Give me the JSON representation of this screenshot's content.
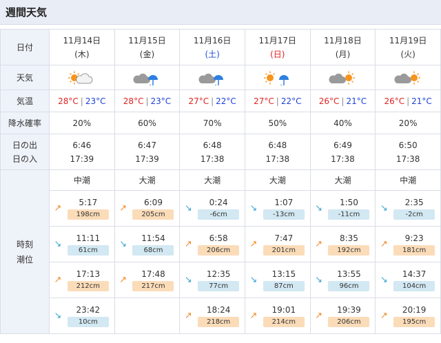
{
  "title": "週間天気",
  "labels": {
    "date": "日付",
    "weather": "天気",
    "temp": "気温",
    "rain": "降水確率",
    "sunrise": "日の出",
    "sunset": "日の入",
    "tide_time": "時刻",
    "tide_level": "潮位"
  },
  "days": [
    {
      "date": "11月14日",
      "dow": "(木)",
      "dow_type": "weekday",
      "weather_icon": "sun-cloud-icon",
      "hi": "28°C",
      "lo": "23°C",
      "rain": "20%",
      "sunrise": "6:46",
      "sunset": "17:39",
      "tide_name": "中潮",
      "tides": [
        {
          "dir": "up",
          "time": "5:17",
          "level": "198cm",
          "type": "high"
        },
        {
          "dir": "down",
          "time": "11:11",
          "level": "61cm",
          "type": "low"
        },
        {
          "dir": "up",
          "time": "17:13",
          "level": "212cm",
          "type": "high"
        },
        {
          "dir": "down",
          "time": "23:42",
          "level": "10cm",
          "type": "low"
        }
      ]
    },
    {
      "date": "11月15日",
      "dow": "(金)",
      "dow_type": "weekday",
      "weather_icon": "cloud-umbrella-icon",
      "hi": "28°C",
      "lo": "23°C",
      "rain": "60%",
      "sunrise": "6:47",
      "sunset": "17:39",
      "tide_name": "大潮",
      "tides": [
        {
          "dir": "up",
          "time": "6:09",
          "level": "205cm",
          "type": "high"
        },
        {
          "dir": "down",
          "time": "11:54",
          "level": "68cm",
          "type": "low"
        },
        {
          "dir": "up",
          "time": "17:48",
          "level": "217cm",
          "type": "high"
        },
        null
      ]
    },
    {
      "date": "11月16日",
      "dow": "(土)",
      "dow_type": "sat",
      "weather_icon": "cloud-umbrella-icon",
      "hi": "27°C",
      "lo": "22°C",
      "rain": "70%",
      "sunrise": "6:48",
      "sunset": "17:38",
      "tide_name": "大潮",
      "tides": [
        {
          "dir": "down",
          "time": "0:24",
          "level": "-6cm",
          "type": "low"
        },
        {
          "dir": "up",
          "time": "6:58",
          "level": "206cm",
          "type": "high"
        },
        {
          "dir": "down",
          "time": "12:35",
          "level": "77cm",
          "type": "low"
        },
        {
          "dir": "up",
          "time": "18:24",
          "level": "218cm",
          "type": "high"
        }
      ]
    },
    {
      "date": "11月17日",
      "dow": "(日)",
      "dow_type": "sun",
      "weather_icon": "sun-umbrella-icon",
      "hi": "27°C",
      "lo": "22°C",
      "rain": "50%",
      "sunrise": "6:48",
      "sunset": "17:38",
      "tide_name": "大潮",
      "tides": [
        {
          "dir": "down",
          "time": "1:07",
          "level": "-13cm",
          "type": "low"
        },
        {
          "dir": "up",
          "time": "7:47",
          "level": "201cm",
          "type": "high"
        },
        {
          "dir": "down",
          "time": "13:15",
          "level": "87cm",
          "type": "low"
        },
        {
          "dir": "up",
          "time": "19:01",
          "level": "214cm",
          "type": "high"
        }
      ]
    },
    {
      "date": "11月18日",
      "dow": "(月)",
      "dow_type": "weekday",
      "weather_icon": "cloud-sun-icon",
      "hi": "26°C",
      "lo": "21°C",
      "rain": "40%",
      "sunrise": "6:49",
      "sunset": "17:38",
      "tide_name": "大潮",
      "tides": [
        {
          "dir": "down",
          "time": "1:50",
          "level": "-11cm",
          "type": "low"
        },
        {
          "dir": "up",
          "time": "8:35",
          "level": "192cm",
          "type": "high"
        },
        {
          "dir": "down",
          "time": "13:55",
          "level": "96cm",
          "type": "low"
        },
        {
          "dir": "up",
          "time": "19:39",
          "level": "206cm",
          "type": "high"
        }
      ]
    },
    {
      "date": "11月19日",
      "dow": "(火)",
      "dow_type": "weekday",
      "weather_icon": "cloud-sun-icon",
      "hi": "26°C",
      "lo": "21°C",
      "rain": "20%",
      "sunrise": "6:50",
      "sunset": "17:38",
      "tide_name": "中潮",
      "tides": [
        {
          "dir": "down",
          "time": "2:35",
          "level": "-2cm",
          "type": "low"
        },
        {
          "dir": "up",
          "time": "9:23",
          "level": "181cm",
          "type": "high"
        },
        {
          "dir": "down",
          "time": "14:37",
          "level": "104cm",
          "type": "low"
        },
        {
          "dir": "up",
          "time": "20:19",
          "level": "195cm",
          "type": "high"
        }
      ]
    }
  ],
  "colors": {
    "high_bg": "#fbdcb9",
    "low_bg": "#d2e8f2",
    "temp_hi": "#e02020",
    "temp_lo": "#1c3fd8"
  }
}
